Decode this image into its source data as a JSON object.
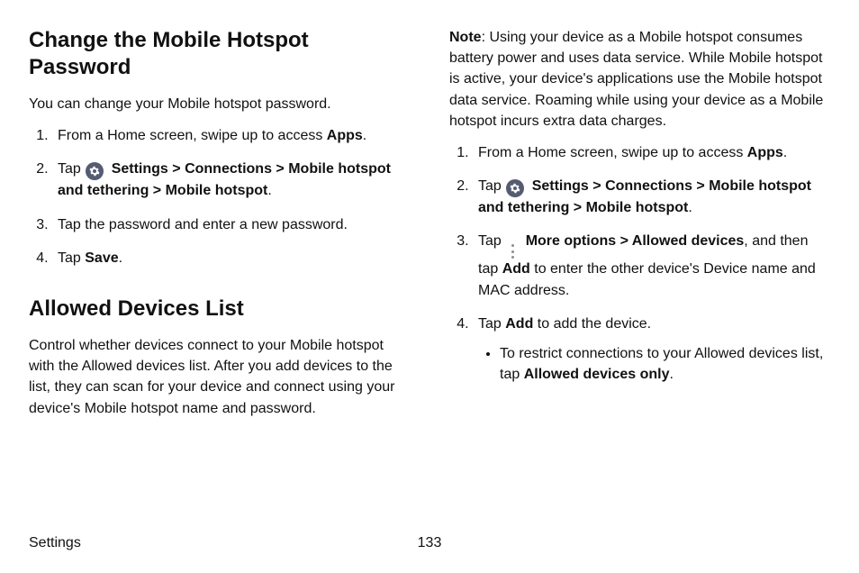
{
  "left": {
    "h1": "Change the Mobile Hotspot Password",
    "intro": "You can change your Mobile hotspot password.",
    "step1_pre": "From a Home screen, swipe up to access ",
    "apps": "Apps",
    "step2_tap": "Tap ",
    "settings": "Settings",
    "gt": ">",
    "connections": "Connections",
    "mobile_hotspot_tether": "Mobile hotspot and tethering",
    "mobile_hotspot": "Mobile hotspot",
    "step3": "Tap the password and enter a new password.",
    "step4_tap": "Tap ",
    "save": "Save",
    "h2": "Allowed Devices List",
    "intro2": "Control whether devices connect to your Mobile hotspot with the Allowed devices list. After you add devices to the list, they can scan for your device and connect using your device's Mobile hotspot name and password."
  },
  "right": {
    "note_label": "Note",
    "note_body": ": Using your device as a Mobile hotspot consumes battery power and uses data service. While Mobile hotspot is active, your device's applications use the Mobile hotspot data service. Roaming while using your device as a Mobile hotspot incurs extra data charges.",
    "step1_pre": "From a Home screen, swipe up to access ",
    "apps": "Apps",
    "step2_tap": "Tap ",
    "settings": "Settings",
    "gt": ">",
    "connections": "Connections",
    "mobile_hotspot_tether": "Mobile hotspot and tethering",
    "mobile_hotspot": "Mobile hotspot",
    "step3_tap": "Tap ",
    "more_options": "More options",
    "allowed_devices": "Allowed devices",
    "step3_mid": ", and then tap ",
    "add": "Add",
    "step3_end": " to enter the other device's Device name and MAC address.",
    "step4_tap": "Tap ",
    "step4_end": " to add the device.",
    "bullet_pre": "To restrict connections to your Allowed devices list, tap ",
    "allowed_only": "Allowed devices only"
  },
  "footer": {
    "section": "Settings",
    "page": "133"
  }
}
